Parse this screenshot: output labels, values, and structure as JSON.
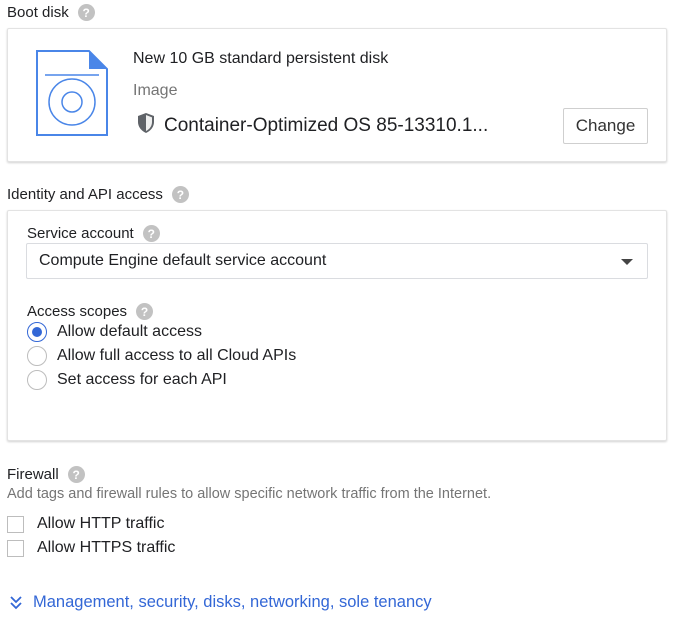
{
  "boot_disk": {
    "title": "Boot disk",
    "help": "?",
    "disk_name": "New 10 GB standard persistent disk",
    "image_label": "Image",
    "os_name": "Container-Optimized OS 85-13310.1...",
    "change_label": "Change"
  },
  "identity": {
    "title": "Identity and API access",
    "help": "?",
    "service_account_label": "Service account",
    "service_account_value": "Compute Engine default service account",
    "access_scopes_label": "Access scopes",
    "scopes": [
      {
        "label": "Allow default access",
        "selected": true
      },
      {
        "label": "Allow full access to all Cloud APIs",
        "selected": false
      },
      {
        "label": "Set access for each API",
        "selected": false
      }
    ]
  },
  "firewall": {
    "title": "Firewall",
    "help": "?",
    "description": "Add tags and firewall rules to allow specific network traffic from the Internet.",
    "options": [
      {
        "label": "Allow HTTP traffic",
        "checked": false
      },
      {
        "label": "Allow HTTPS traffic",
        "checked": false
      }
    ]
  },
  "more_link": "Management, security, disks, networking, sole tenancy",
  "colors": {
    "accent": "#3367d6",
    "disk_icon_blue": "#4a86e8",
    "help_gray": "#c2c2c2"
  },
  "icons": {
    "help": "help-circle-icon",
    "disk": "disk-image-icon",
    "shield": "shield-icon",
    "expand": "double-chevron-down-icon",
    "dropdown": "caret-down-icon"
  }
}
